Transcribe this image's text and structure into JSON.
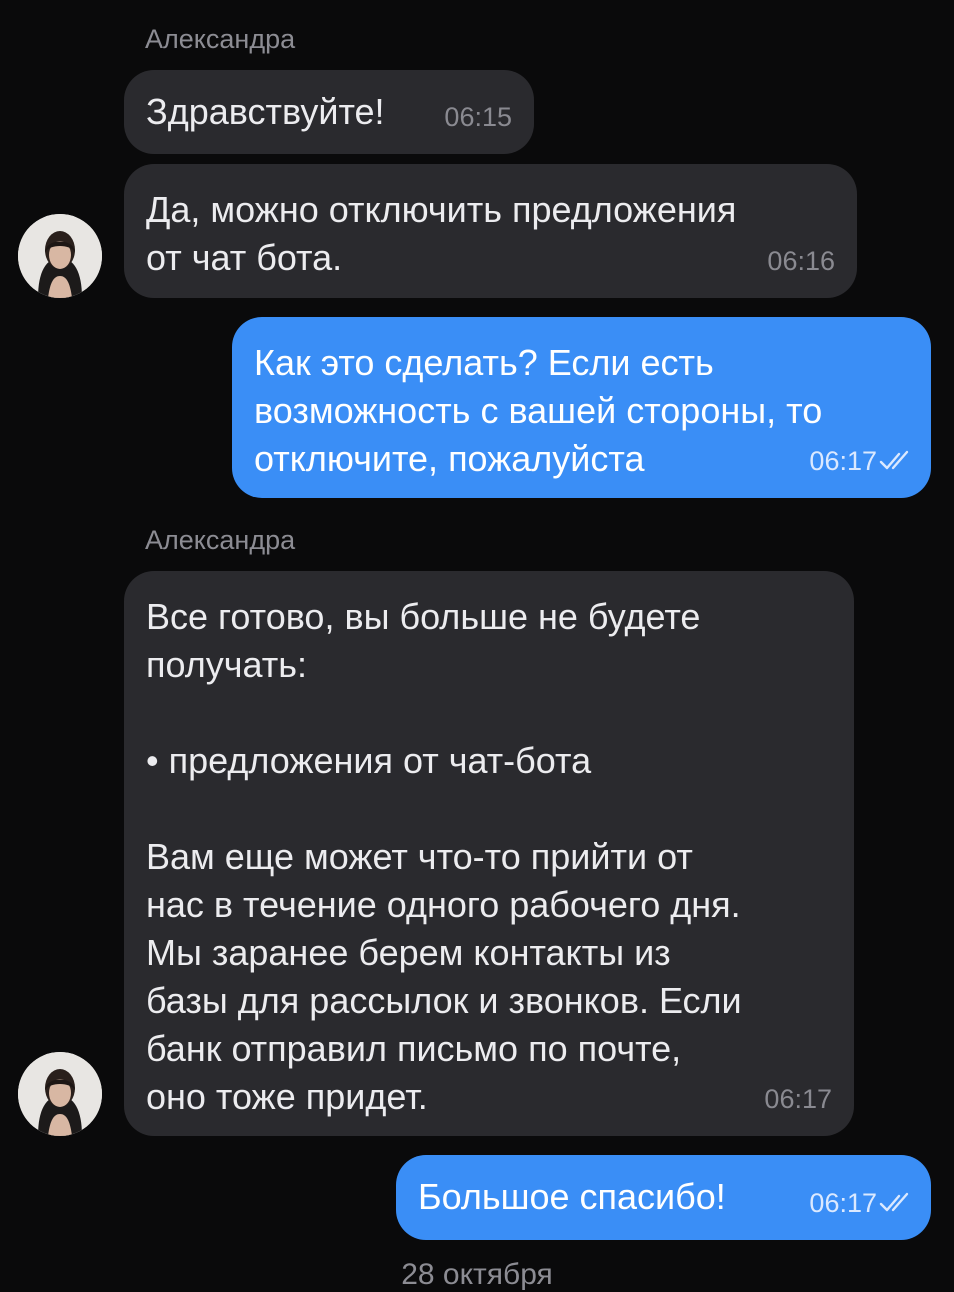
{
  "messages": [
    {
      "sender": "Александра",
      "text": "Здравствуйте!",
      "time": "06:15"
    },
    {
      "text": "Да, можно отключить предложения\nот чат бота.",
      "time": "06:16"
    },
    {
      "text": "Как это сделать? Если есть\nвозможность с вашей стороны, то\nотключите, пожалуйста",
      "time": "06:17",
      "status_icon": "double-check-icon"
    },
    {
      "sender": "Александра",
      "text": "Все готово, вы больше не будете\nполучать:\n\n• предложения от чат-бота\n\nВам еще может что-то прийти от\nнас в течение одного рабочего дня.\nМы заранее берем контакты из\nбазы для рассылок и звонков. Если\nбанк отправил письмо по почте,\nоно тоже придет.",
      "time": "06:17"
    },
    {
      "text": "Большое спасибо!",
      "time": "06:17",
      "status_icon": "double-check-icon"
    }
  ],
  "date_separator": "28 октября",
  "colors": {
    "background": "#0a0a0b",
    "incoming_bubble": "#2a2a2e",
    "outgoing_bubble": "#3a8ef6",
    "sender_name": "#8c8c93"
  }
}
